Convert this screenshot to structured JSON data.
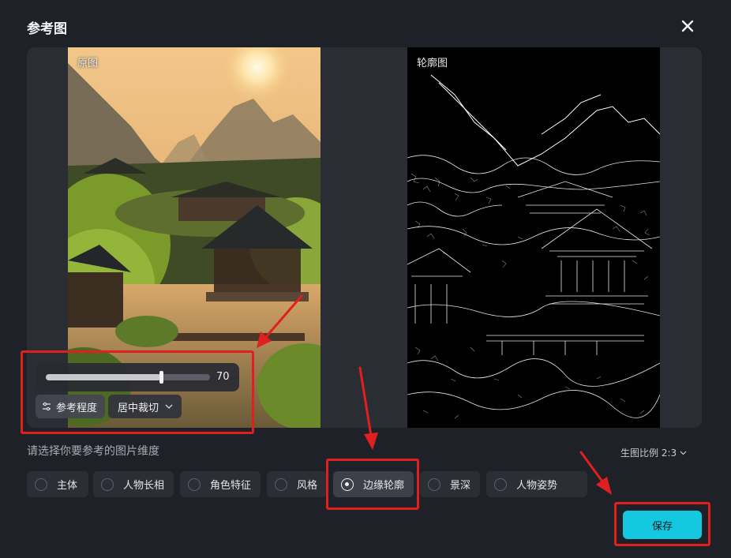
{
  "dialog": {
    "title": "参考图",
    "close_icon": "close-icon"
  },
  "preview": {
    "original_label": "原图",
    "edge_label": "轮廓图"
  },
  "controls": {
    "strength_value": "70",
    "strength_fraction": 0.7,
    "strength_label": "参考程度",
    "crop_label": "居中裁切"
  },
  "prompt": "请选择你要参考的图片维度",
  "ratio_label": "生图比例 2:3",
  "options": [
    {
      "label": "主体",
      "selected": false
    },
    {
      "label": "人物长相",
      "selected": false
    },
    {
      "label": "角色特征",
      "selected": false
    },
    {
      "label": "风格",
      "selected": false
    },
    {
      "label": "边缘轮廓",
      "selected": true
    },
    {
      "label": "景深",
      "selected": false
    },
    {
      "label": "人物姿势",
      "selected": false
    }
  ],
  "save_label": "保存",
  "colors": {
    "background": "#1f2128",
    "accent": "#14c8e0",
    "annotation": "#e0201e"
  }
}
